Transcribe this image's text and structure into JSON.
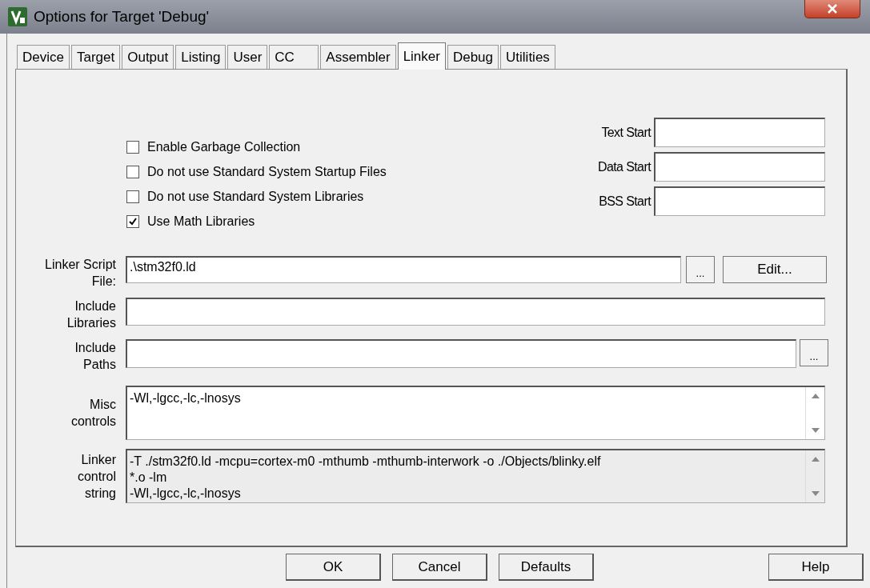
{
  "window": {
    "title": "Options for Target 'Debug'"
  },
  "tabs": [
    {
      "label": "Device",
      "selected": false
    },
    {
      "label": "Target",
      "selected": false
    },
    {
      "label": "Output",
      "selected": false
    },
    {
      "label": "Listing",
      "selected": false
    },
    {
      "label": "User",
      "selected": false
    },
    {
      "label": "CC",
      "selected": false
    },
    {
      "label": "Assembler",
      "selected": false
    },
    {
      "label": "Linker",
      "selected": true
    },
    {
      "label": "Debug",
      "selected": false
    },
    {
      "label": "Utilities",
      "selected": false
    }
  ],
  "checkboxes": [
    {
      "label": "Enable Garbage Collection",
      "checked": false
    },
    {
      "label": "Do not use Standard System Startup Files",
      "checked": false
    },
    {
      "label": "Do not use Standard System Libraries",
      "checked": false
    },
    {
      "label": "Use Math Libraries",
      "checked": true
    }
  ],
  "address_fields": [
    {
      "label": "Text Start"
    },
    {
      "label": "Data Start"
    },
    {
      "label": "BSS Start"
    }
  ],
  "linker_script_file": {
    "label_lines": [
      "Linker Script",
      "File:"
    ],
    "value": ".\\stm32f0.ld",
    "browse_button": "...",
    "edit_button": "Edit..."
  },
  "include_libraries": {
    "label_lines": [
      "Include",
      "Libraries"
    ]
  },
  "include_paths": {
    "label_lines": [
      "Include",
      "Paths"
    ],
    "browse_button": "..."
  },
  "misc_controls": {
    "label_lines": [
      "Misc",
      "controls"
    ],
    "value": "-Wl,-lgcc,-lc,-lnosys"
  },
  "linker_control_string": {
    "label_lines": [
      "Linker",
      "control",
      "string"
    ],
    "lines": [
      "-T ./stm32f0.ld -mcpu=cortex-m0 -mthumb -mthumb-interwork -o ./Objects/blinky.elf",
      "*.o -lm",
      "-Wl,-lgcc,-lc,-lnosys"
    ]
  },
  "buttons": [
    {
      "label": "OK",
      "kind": "ok"
    },
    {
      "label": "Cancel",
      "kind": "cancel"
    },
    {
      "label": "Defaults",
      "kind": "defaults"
    },
    {
      "label": "Help",
      "kind": "help"
    }
  ]
}
